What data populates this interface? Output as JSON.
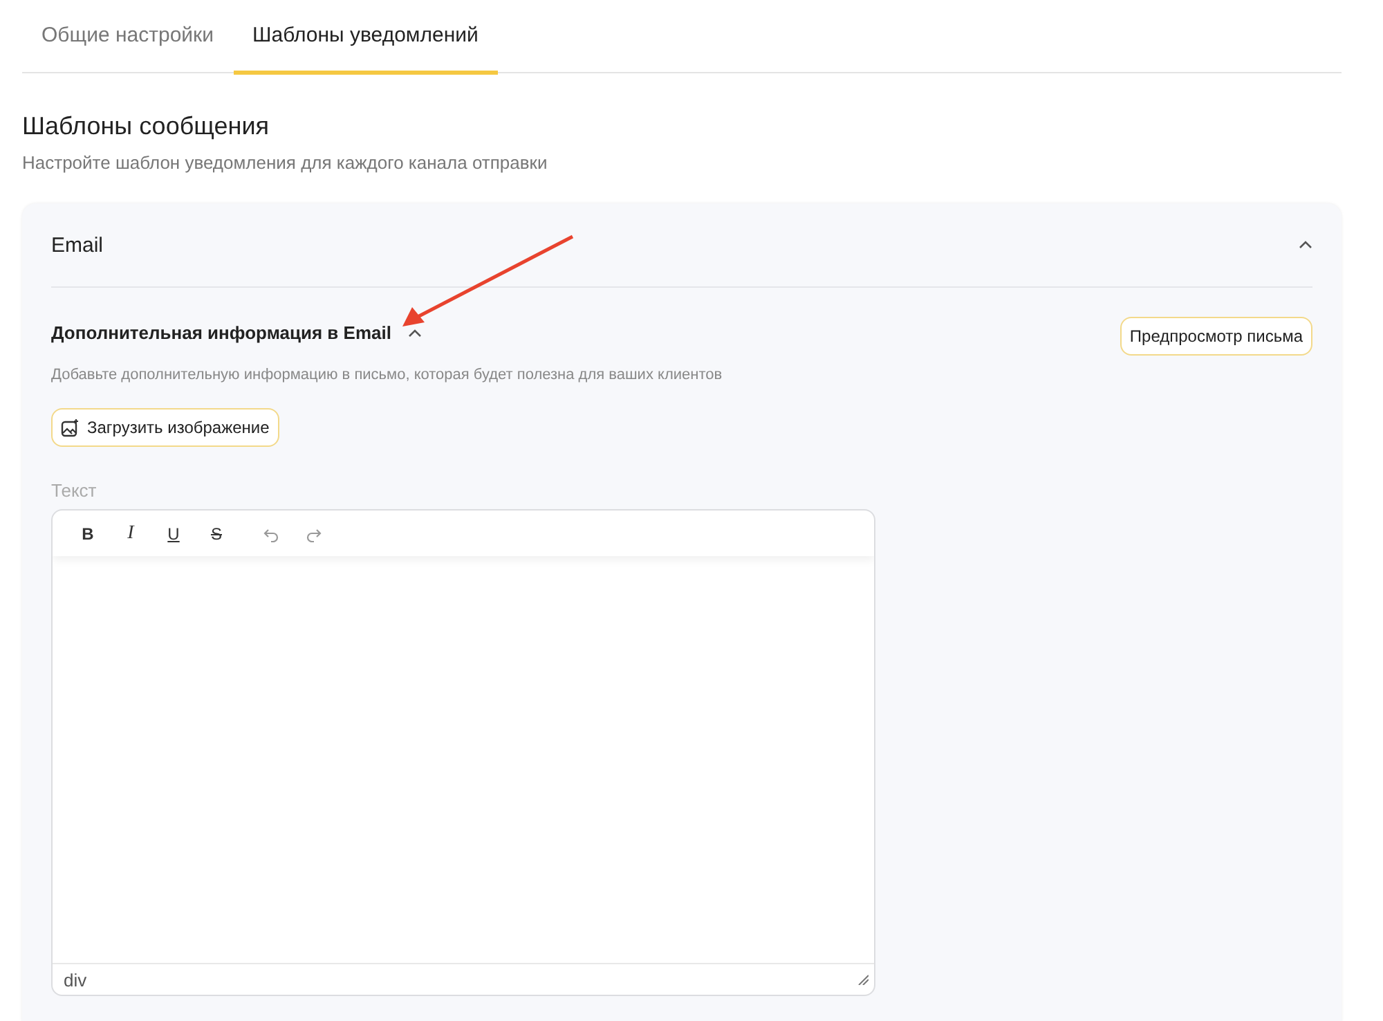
{
  "tabs": [
    {
      "label": "Общие настройки",
      "selected": false
    },
    {
      "label": "Шаблоны уведомлений",
      "selected": true
    }
  ],
  "heading": "Шаблоны сообщения",
  "subheading": "Настройте шаблон уведомления для каждого канала отправки",
  "channel": {
    "title": "Email",
    "expanded": true,
    "section": {
      "title": "Дополнительная информация в Email",
      "expanded": true,
      "description": "Добавьте дополнительную информацию в письмо, которая будет полезна для ваших клиентов",
      "preview_button": "Предпросмотр письма",
      "upload_button": "Загрузить изображение"
    },
    "editor": {
      "label": "Текст",
      "format_buttons": [
        {
          "kind": "bold",
          "label": "B"
        },
        {
          "kind": "italic",
          "label": "I"
        },
        {
          "kind": "underline",
          "label": "U"
        },
        {
          "kind": "strike",
          "label": "S"
        }
      ],
      "history_buttons": [
        {
          "kind": "undo"
        },
        {
          "kind": "redo"
        }
      ],
      "path": "div"
    }
  }
}
